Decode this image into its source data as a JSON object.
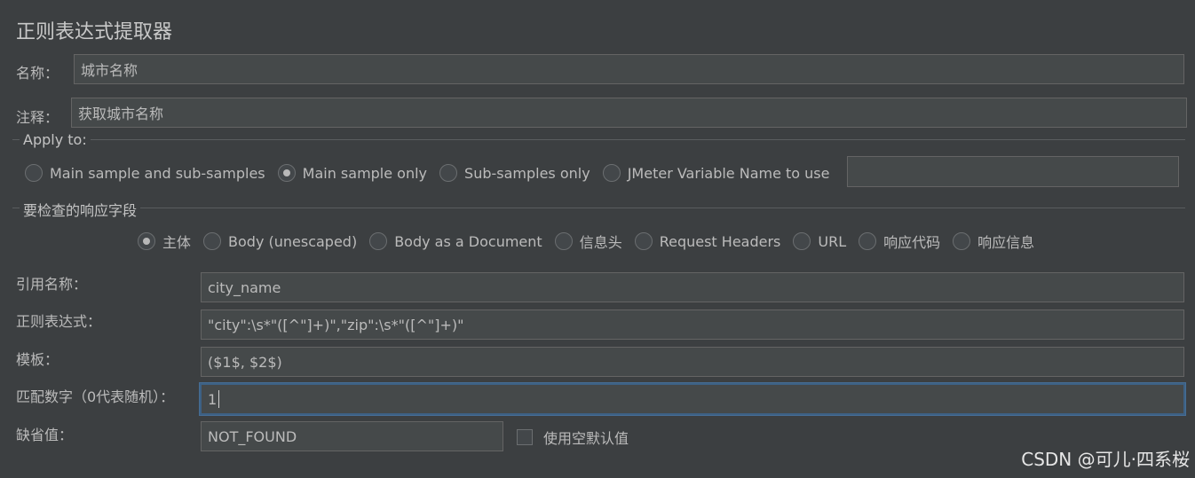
{
  "panel": {
    "title": "正则表达式提取器"
  },
  "name_row": {
    "label": "名称：",
    "value": "城市名称"
  },
  "comment_row": {
    "label": "注释：",
    "value": "获取城市名称"
  },
  "apply_to": {
    "legend": "Apply to:",
    "options": [
      {
        "label": "Main sample and sub-samples",
        "selected": false
      },
      {
        "label": "Main sample only",
        "selected": true
      },
      {
        "label": "Sub-samples only",
        "selected": false
      },
      {
        "label": "JMeter Variable Name to use",
        "selected": false
      }
    ],
    "variable_value": ""
  },
  "response_field": {
    "legend": "要检查的响应字段",
    "options": [
      {
        "label": "主体",
        "selected": true
      },
      {
        "label": "Body (unescaped)",
        "selected": false
      },
      {
        "label": "Body as a Document",
        "selected": false
      },
      {
        "label": "信息头",
        "selected": false
      },
      {
        "label": "Request Headers",
        "selected": false
      },
      {
        "label": "URL",
        "selected": false
      },
      {
        "label": "响应代码",
        "selected": false
      },
      {
        "label": "响应信息",
        "selected": false
      }
    ]
  },
  "form": {
    "ref_name": {
      "label": "引用名称：",
      "value": "city_name"
    },
    "regex": {
      "label": "正则表达式：",
      "value": "\"city\":\\s*\"([^\"]+)\",\"zip\":\\s*\"([^\"]+)\""
    },
    "template": {
      "label": "模板：",
      "value": "($1$, $2$)"
    },
    "match_no": {
      "label": "匹配数字（0代表随机）：",
      "value": "1"
    },
    "default_value": {
      "label": "缺省值：",
      "value": "NOT_FOUND"
    },
    "use_empty_default": {
      "label": "使用空默认值",
      "checked": false
    }
  },
  "watermark": "CSDN @可儿·四系桜",
  "colors": {
    "background": "#3c3f41",
    "field": "#45494a",
    "focus_border": "#3d6185"
  }
}
